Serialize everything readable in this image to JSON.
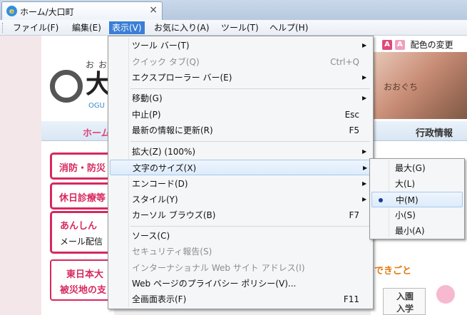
{
  "browser": {
    "tab_title": "ホーム/大口町",
    "tab_close": "×",
    "tab_icon_glyph": "e"
  },
  "menubar": {
    "items": [
      {
        "label": "ファイル(F)"
      },
      {
        "label": "編集(E)"
      },
      {
        "label": "表示(V)",
        "active": true
      },
      {
        "label": "お気に入り(A)"
      },
      {
        "label": "ツール(T)"
      },
      {
        "label": "ヘルプ(H)"
      }
    ]
  },
  "view_menu": {
    "items": [
      {
        "label": "ツール バー(T)",
        "submenu": true
      },
      {
        "label": "クイック タブ(Q)",
        "shortcut": "Ctrl+Q",
        "disabled": true
      },
      {
        "label": "エクスプローラー バー(E)",
        "submenu": true
      },
      {
        "label": "移動(G)",
        "submenu": true
      },
      {
        "label": "中止(P)",
        "shortcut": "Esc"
      },
      {
        "label": "最新の情報に更新(R)",
        "shortcut": "F5"
      },
      {
        "label": "拡大(Z) (100%)",
        "submenu": true
      },
      {
        "label": "文字のサイズ(X)",
        "submenu": true,
        "highlighted": true
      },
      {
        "label": "エンコード(D)",
        "submenu": true
      },
      {
        "label": "スタイル(Y)",
        "submenu": true
      },
      {
        "label": "カーソル ブラウズ(B)",
        "shortcut": "F7"
      },
      {
        "label": "ソース(C)"
      },
      {
        "label": "セキュリティ報告(S)",
        "disabled": true
      },
      {
        "label": "インターナショナル Web サイト アドレス(I)",
        "disabled": true
      },
      {
        "label": "Web ページのプライバシー ポリシー(V)..."
      },
      {
        "label": "全画面表示(F)",
        "shortcut": "F11"
      }
    ],
    "arrow_glyph": "▶"
  },
  "text_size_submenu": {
    "items": [
      {
        "label": "最大(G)"
      },
      {
        "label": "大(L)"
      },
      {
        "label": "中(M)",
        "selected": true
      },
      {
        "label": "小(S)"
      },
      {
        "label": "最小(A)"
      }
    ]
  },
  "page": {
    "a_large": "A",
    "a_small": "A",
    "color_change": "配色の変更",
    "logo_ruby": "おお",
    "logo_big": "大",
    "logo_en": "OGU",
    "banner_text": "おおぐち",
    "nav_home": "ホーム",
    "nav_gyosei": "行政情報",
    "side_bousai": "消防・防災",
    "side_kyujitsu": "休日診療等",
    "anshin_title": "あんしん",
    "anshin_sub": "メール配信",
    "quake_line1": "東日本大",
    "quake_line2": "被災地の支",
    "dekigoto": "のできごと",
    "nyuen_1": "入園",
    "nyuen_2": "入学"
  },
  "colors": {
    "menu_active": "#3a7fd6",
    "accent_pink": "#d7285e",
    "menu_bg": "#f5f6f7"
  }
}
